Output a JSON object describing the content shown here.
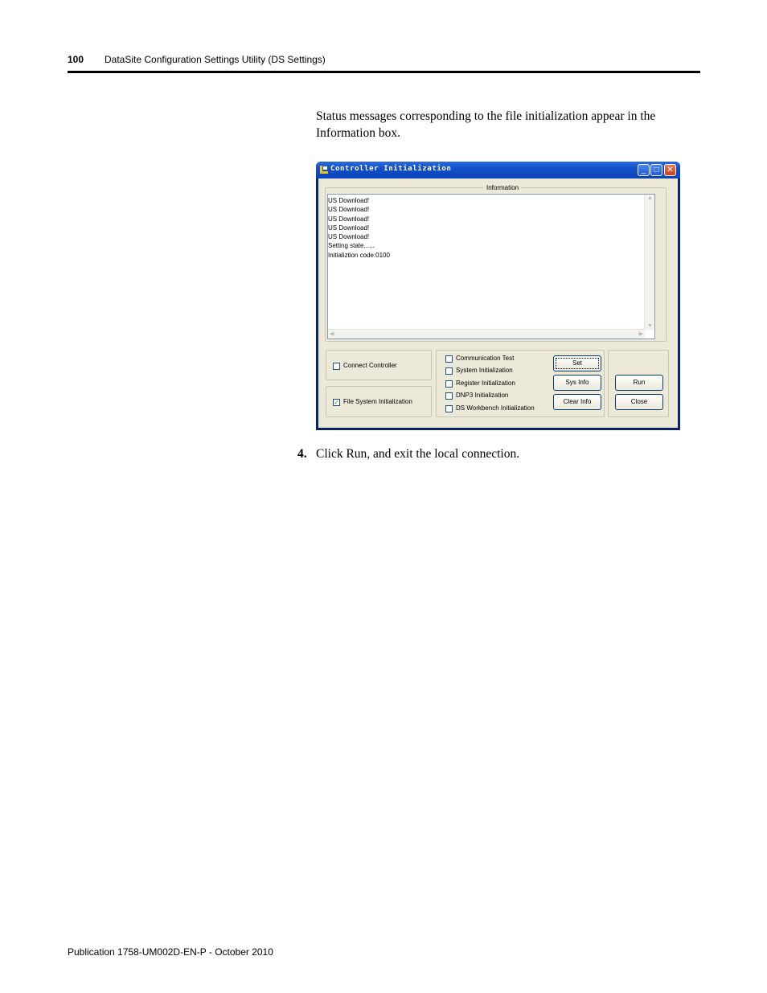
{
  "header": {
    "page_number": "100",
    "title": "DataSite Configuration Settings Utility (DS Settings)"
  },
  "body": {
    "paragraph": "Status messages corresponding to the file initialization appear in the Information box.",
    "step_number": "4.",
    "step_text": "Click Run, and exit the local connection."
  },
  "dialog": {
    "title": "Controller Initialization",
    "controls": {
      "minimize": "_",
      "maximize": "□",
      "close": "✕"
    },
    "information": {
      "label": "Information",
      "lines": [
        "US Download!",
        "US Download!",
        "US Download!",
        "US Download!",
        "US Download!",
        "Setting state......",
        "Initializtion code:0100"
      ]
    },
    "left_options": [
      {
        "label": "Connect Controller",
        "checked": false
      },
      {
        "label": "File System Initialization",
        "checked": true
      }
    ],
    "middle_options": [
      {
        "label": "Communication Test",
        "checked": false
      },
      {
        "label": "System Initialization",
        "checked": false
      },
      {
        "label": "Register Initialization",
        "checked": false
      },
      {
        "label": "DNP3 Initialization",
        "checked": false
      },
      {
        "label": "DS Workbench Initialization",
        "checked": false
      }
    ],
    "buttons": {
      "set": "Set",
      "sys_info": "Sys Info",
      "clear_info": "Clear Info",
      "run": "Run",
      "close": "Close"
    },
    "check_mark": "✓",
    "colors": {
      "titlebar": "#0b43b8",
      "face": "#ece9d8",
      "close_button": "#c8401c"
    }
  },
  "footer": {
    "publication": "Publication 1758-UM002D-EN-P - October 2010"
  }
}
